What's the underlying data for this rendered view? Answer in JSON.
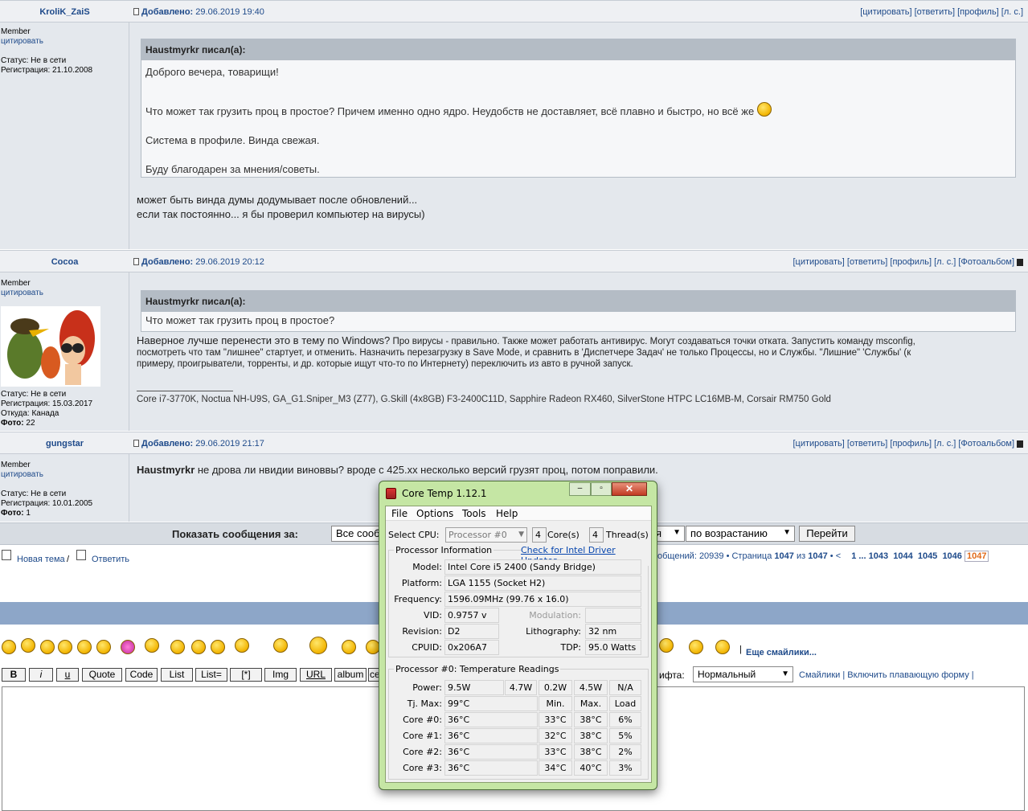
{
  "posts": [
    {
      "author": "KroliK_ZaiS",
      "date_prefix": "Добавлено:",
      "date": "29.06.2019 19:40",
      "links": "[цитировать] [ответить] [профиль] [л. с.]",
      "rank": "Member",
      "quote_link": "цитировать",
      "status": "Статус: Не в сети",
      "registration": "Регистрация: 21.10.2008",
      "quote_author": "Haustmyrkr писал(а):",
      "quote_lines": [
        "Доброго вечера, товарищи!",
        "Что может так грузить проц в простое? Причем именно одно ядро. Неудобств не доставляет, всё плавно и быстро, но всё же",
        "Система в профиле. Винда свежая.",
        "Буду благодарен за мнения/советы."
      ],
      "body_lines": [
        "может быть винда думы додумывает после обновлений...",
        "если так постоянно... я бы проверил компьютер на вирусы)"
      ]
    },
    {
      "author": "Cocoa",
      "date_prefix": "Добавлено:",
      "date": "29.06.2019 20:12",
      "links": "[цитировать] [ответить] [профиль] [л. с.] [Фотоальбом]",
      "rank": "Member",
      "quote_link": "цитировать",
      "status": "Статус: Не в сети",
      "registration": "Регистрация: 15.03.2017",
      "from": "Откуда: Канада",
      "photo_label": "Фото:",
      "photo_count": "22",
      "quote_author": "Haustmyrkr писал(а):",
      "quote_line": "Что может так грузить проц в простое?",
      "body_big": "Наверное лучше перенести это в тему по Windows?",
      "body_rest": "Про вирусы - правильно. Также может работать антивирус. Могут создаваться точки отката. Запустить команду msconfig,",
      "body_line2": "посмотреть что там \"лишнее\" стартует, и отменить. Назначить перезагрузку в Save Mode, и сравнить в 'Диспетчере Задач' не только Процессы, но и Службы. \"Лишние\" 'Службы' (к",
      "body_line3": "примеру, проигрыватели, торренты, и др. которые ищут что-то по Интернету) переключить из авто в ручной запуск.",
      "signature": "Core i7-3770K, Noctua NH-U9S, GA_G1.Sniper_M3 (Z77), G.Skill (4x8GB) F3-2400C11D, Sapphire Radeon RX460, SilverStone HTPC LC16MB-M, Corsair RM750 Gold"
    },
    {
      "author": "gungstar",
      "date_prefix": "Добавлено:",
      "date": "29.06.2019 21:17",
      "links": "[цитировать] [ответить] [профиль] [л. с.] [Фотоальбом]",
      "rank": "Member",
      "quote_link": "цитировать",
      "status": "Статус: Не в сети",
      "registration": "Регистрация: 10.01.2005",
      "photo_label": "Фото:",
      "photo_count": "1",
      "body_bold": "Haustmyrkr",
      "body_text": " не дрова ли нвидии виноввы? вроде с 425.xx несколько версий грузят проц, потом поправили."
    }
  ],
  "filter": {
    "label": "Показать сообщения за:",
    "period_value": "Все сооб",
    "period_value_right": "я",
    "order_value": "по возрастанию",
    "go_button": "Перейти"
  },
  "actions": {
    "new_topic": "Новая тема",
    "separator": "/",
    "reply": "Ответить"
  },
  "pagination": {
    "messages_text": "общений: 20939 • Страница",
    "current": "1047",
    "of": "из",
    "total": "1047",
    "sep": "• <",
    "pages": [
      "1",
      "...",
      "1043",
      "1044",
      "1045",
      "1046"
    ],
    "active": "1047"
  },
  "editor": {
    "more_smilies": "Еще смайлики...",
    "buttons": [
      "B",
      "i",
      "u",
      "Quote",
      "Code",
      "List",
      "List=",
      "[*]",
      "Img",
      "URL",
      "album",
      "ce"
    ],
    "font_label": "ифта:",
    "font_value": "Нормальный",
    "smilies_link": "Смайлики",
    "float_link": "Включить плавающую форму"
  },
  "coretemp": {
    "title": "Core Temp 1.12.1",
    "menu": [
      "File",
      "Options",
      "Tools",
      "Help"
    ],
    "select_cpu_label": "Select CPU:",
    "cpu_value": "Processor #0",
    "cores": "4",
    "cores_label": "Core(s)",
    "threads": "4",
    "threads_label": "Thread(s)",
    "proc_info_label": "Processor Information",
    "driver_link": "Check for Intel Driver Updates",
    "model_label": "Model:",
    "model": "Intel Core i5 2400 (Sandy Bridge)",
    "platform_label": "Platform:",
    "platform": "LGA 1155 (Socket H2)",
    "frequency_label": "Frequency:",
    "frequency": "1596.09MHz (99.76 x 16.0)",
    "vid_label": "VID:",
    "vid": "0.9757 v",
    "modulation_label": "Modulation:",
    "modulation": "",
    "revision_label": "Revision:",
    "revision": "D2",
    "lithography_label": "Lithography:",
    "lithography": "32 nm",
    "cpuid_label": "CPUID:",
    "cpuid": "0x206A7",
    "tdp_label": "TDP:",
    "tdp": "95.0 Watts",
    "temp_header": "Processor #0: Temperature Readings",
    "power_label": "Power:",
    "power": [
      "9.5W",
      "4.7W",
      "0.2W",
      "4.5W",
      "N/A"
    ],
    "tjmax_label": "Tj. Max:",
    "tjmax": "99°C",
    "col_min": "Min.",
    "col_max": "Max.",
    "col_load": "Load",
    "cores_rows": [
      {
        "label": "Core #0:",
        "temp": "36°C",
        "min": "33°C",
        "max": "38°C",
        "load": "6%"
      },
      {
        "label": "Core #1:",
        "temp": "36°C",
        "min": "32°C",
        "max": "38°C",
        "load": "5%"
      },
      {
        "label": "Core #2:",
        "temp": "36°C",
        "min": "33°C",
        "max": "38°C",
        "load": "2%"
      },
      {
        "label": "Core #3:",
        "temp": "36°C",
        "min": "34°C",
        "max": "40°C",
        "load": "3%"
      }
    ]
  }
}
